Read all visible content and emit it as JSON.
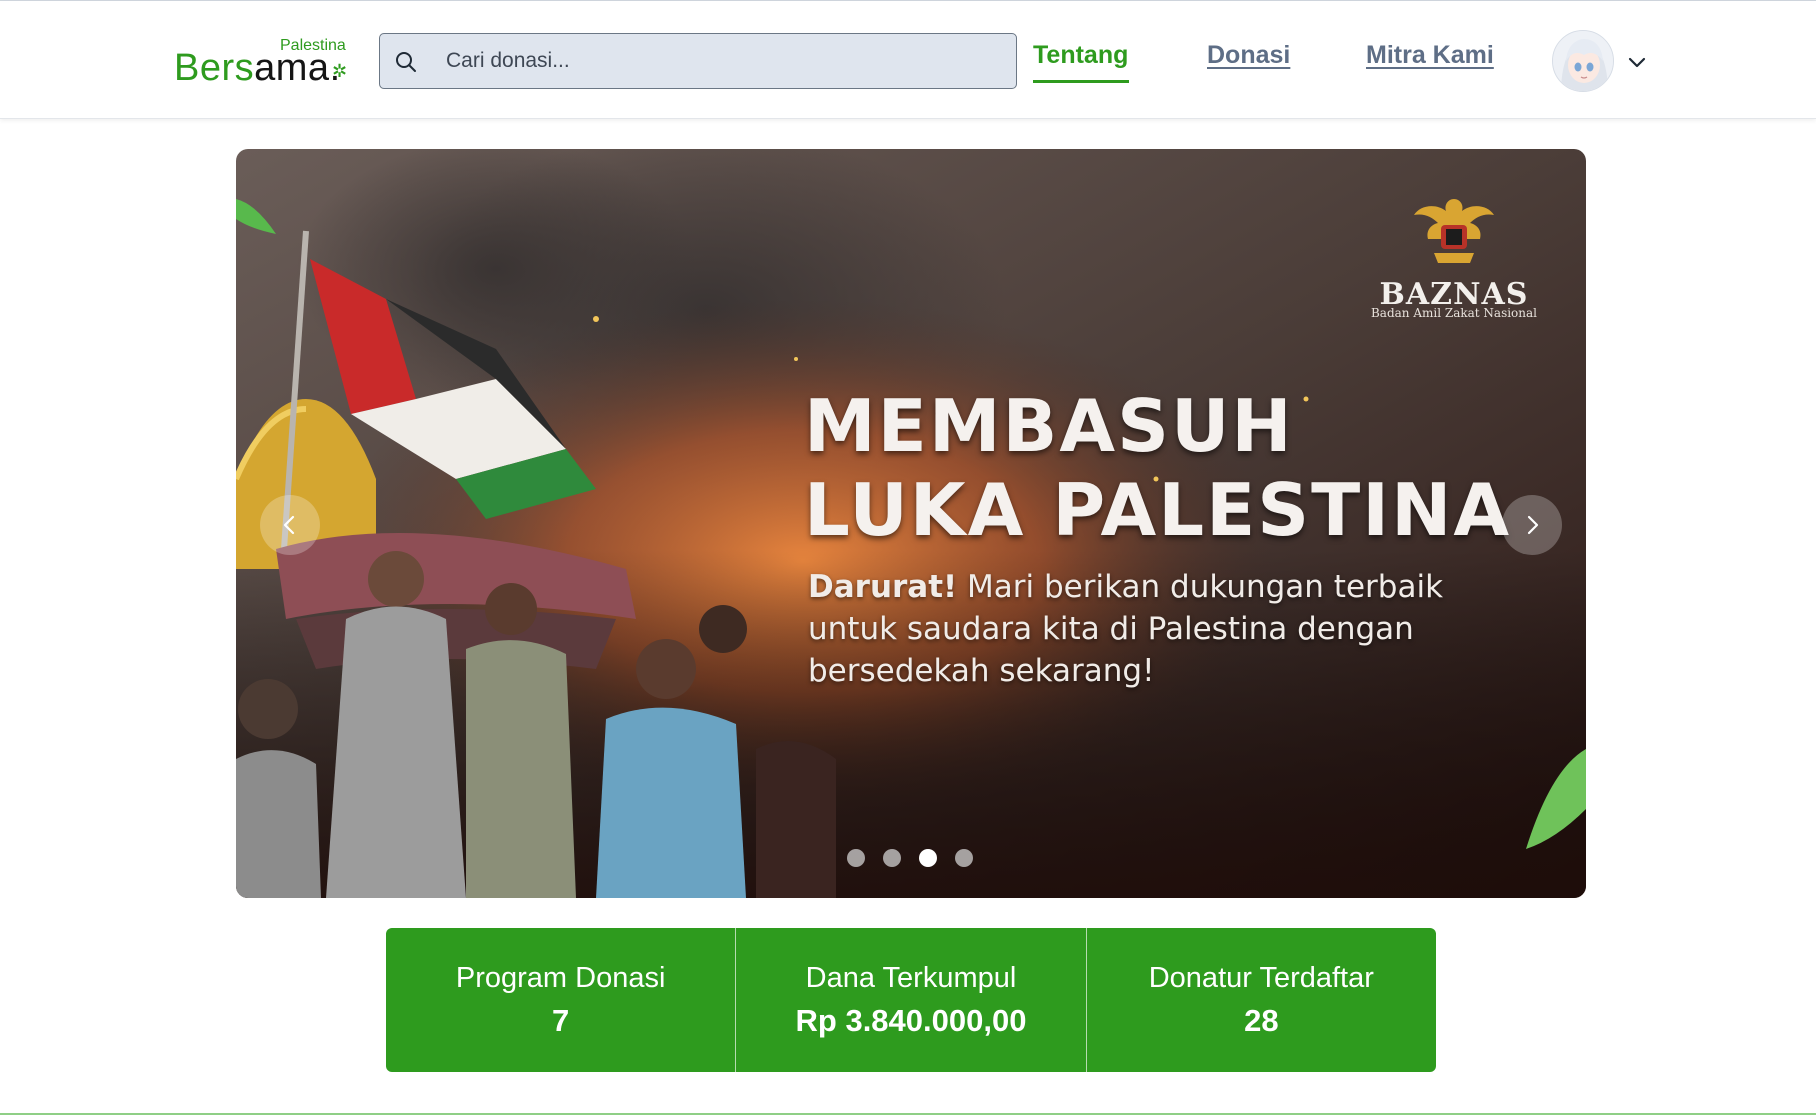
{
  "logo": {
    "sub": "Palestina",
    "main_green": "Bers",
    "main_dark": "ama",
    "dot": "."
  },
  "search": {
    "placeholder": "Cari donasi..."
  },
  "nav": {
    "links": [
      {
        "label": "Tentang",
        "active": true
      },
      {
        "label": "Donasi",
        "active": false
      },
      {
        "label": "Mitra Kami",
        "active": false
      }
    ]
  },
  "carousel": {
    "headline_line1": "MEMBASUH",
    "headline_line2": "LUKA PALESTINA",
    "subtext_bold": "Darurat!",
    "subtext_rest": "Mari berikan dukungan terbaik untuk saudara kita di Palestina dengan bersedekah sekarang!",
    "badge_name": "BAZNAS",
    "badge_tagline": "Badan Amil Zakat Nasional",
    "total_slides": 4,
    "active_slide": 3
  },
  "stats": [
    {
      "label": "Program Donasi",
      "value": "7"
    },
    {
      "label": "Dana Terkumpul",
      "value": "Rp 3.840.000,00"
    },
    {
      "label": "Donatur Terdaftar",
      "value": "28"
    }
  ],
  "colors": {
    "brand_green": "#2e9b1e",
    "nav_link": "#5e6e86",
    "search_bg": "#dfe5ee"
  }
}
